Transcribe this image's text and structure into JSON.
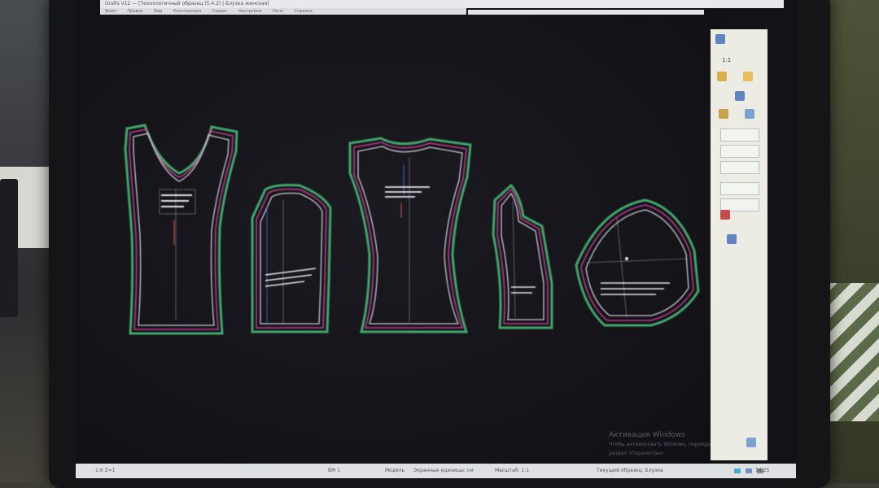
{
  "app": {
    "title": "Grafis  V12 — [Технологичный образец (5.4.2) | Блузка женская]",
    "menu": [
      "Файл",
      "Правка",
      "Вид",
      "Конструкция",
      "Сервис",
      "Настройки",
      "Окно",
      "Справка"
    ]
  },
  "toolbar": {
    "buttons": [
      {
        "icon": "save-icon",
        "color": "#e0b84a"
      },
      {
        "icon": "open-icon",
        "color": "#d9c070"
      },
      {
        "icon": "print-icon",
        "color": "#7f9a57"
      },
      {
        "icon": "cut-icon",
        "color": "#c58c3a"
      },
      {
        "icon": "undo-icon",
        "color": "#5d86c2"
      },
      {
        "icon": "redo-icon",
        "color": "#7aa1cf"
      },
      {
        "icon": "zoom-icon",
        "color": "#d0a94b"
      },
      {
        "icon": "grid-icon",
        "color": "#e0c276"
      },
      {
        "icon": "pattern-icon",
        "color": "#b98d3c"
      },
      {
        "icon": "measure-icon",
        "color": "#e4c15e"
      },
      {
        "icon": "layer-icon",
        "color": "#6d93c9"
      },
      {
        "icon": "settings-icon",
        "color": "#d9b25a"
      },
      {
        "icon": "help-icon",
        "color": "#7aa1cf"
      }
    ]
  },
  "right_panel": {
    "readout": "1:1"
  },
  "watermark": {
    "line1": "Активация Windows",
    "line2": "Чтобы активировать Windows, перейдите в раздел «Параметры»."
  },
  "status_bar": {
    "left": "1:6  Z=1",
    "mid1": "BM 1",
    "mid2": "Модель",
    "mid3": "Экранные единицы: см",
    "mid4": "Масштаб: 1:1",
    "right": "Текущий образец: Блузка",
    "clock": "14:25"
  },
  "colors": {
    "screen_bg": "#131217",
    "pattern_outline": "#c7c9cf",
    "seam_green": "#3fa66b",
    "seam_magenta": "#c0398f",
    "seam_blue": "#4a63c9",
    "marking_white": "#e6e6ea",
    "marking_red": "#e05050"
  },
  "pattern_pieces": [
    {
      "name": "front-bodice"
    },
    {
      "name": "side-panel-left"
    },
    {
      "name": "back-bodice"
    },
    {
      "name": "side-panel-right"
    },
    {
      "name": "sleeve"
    }
  ]
}
